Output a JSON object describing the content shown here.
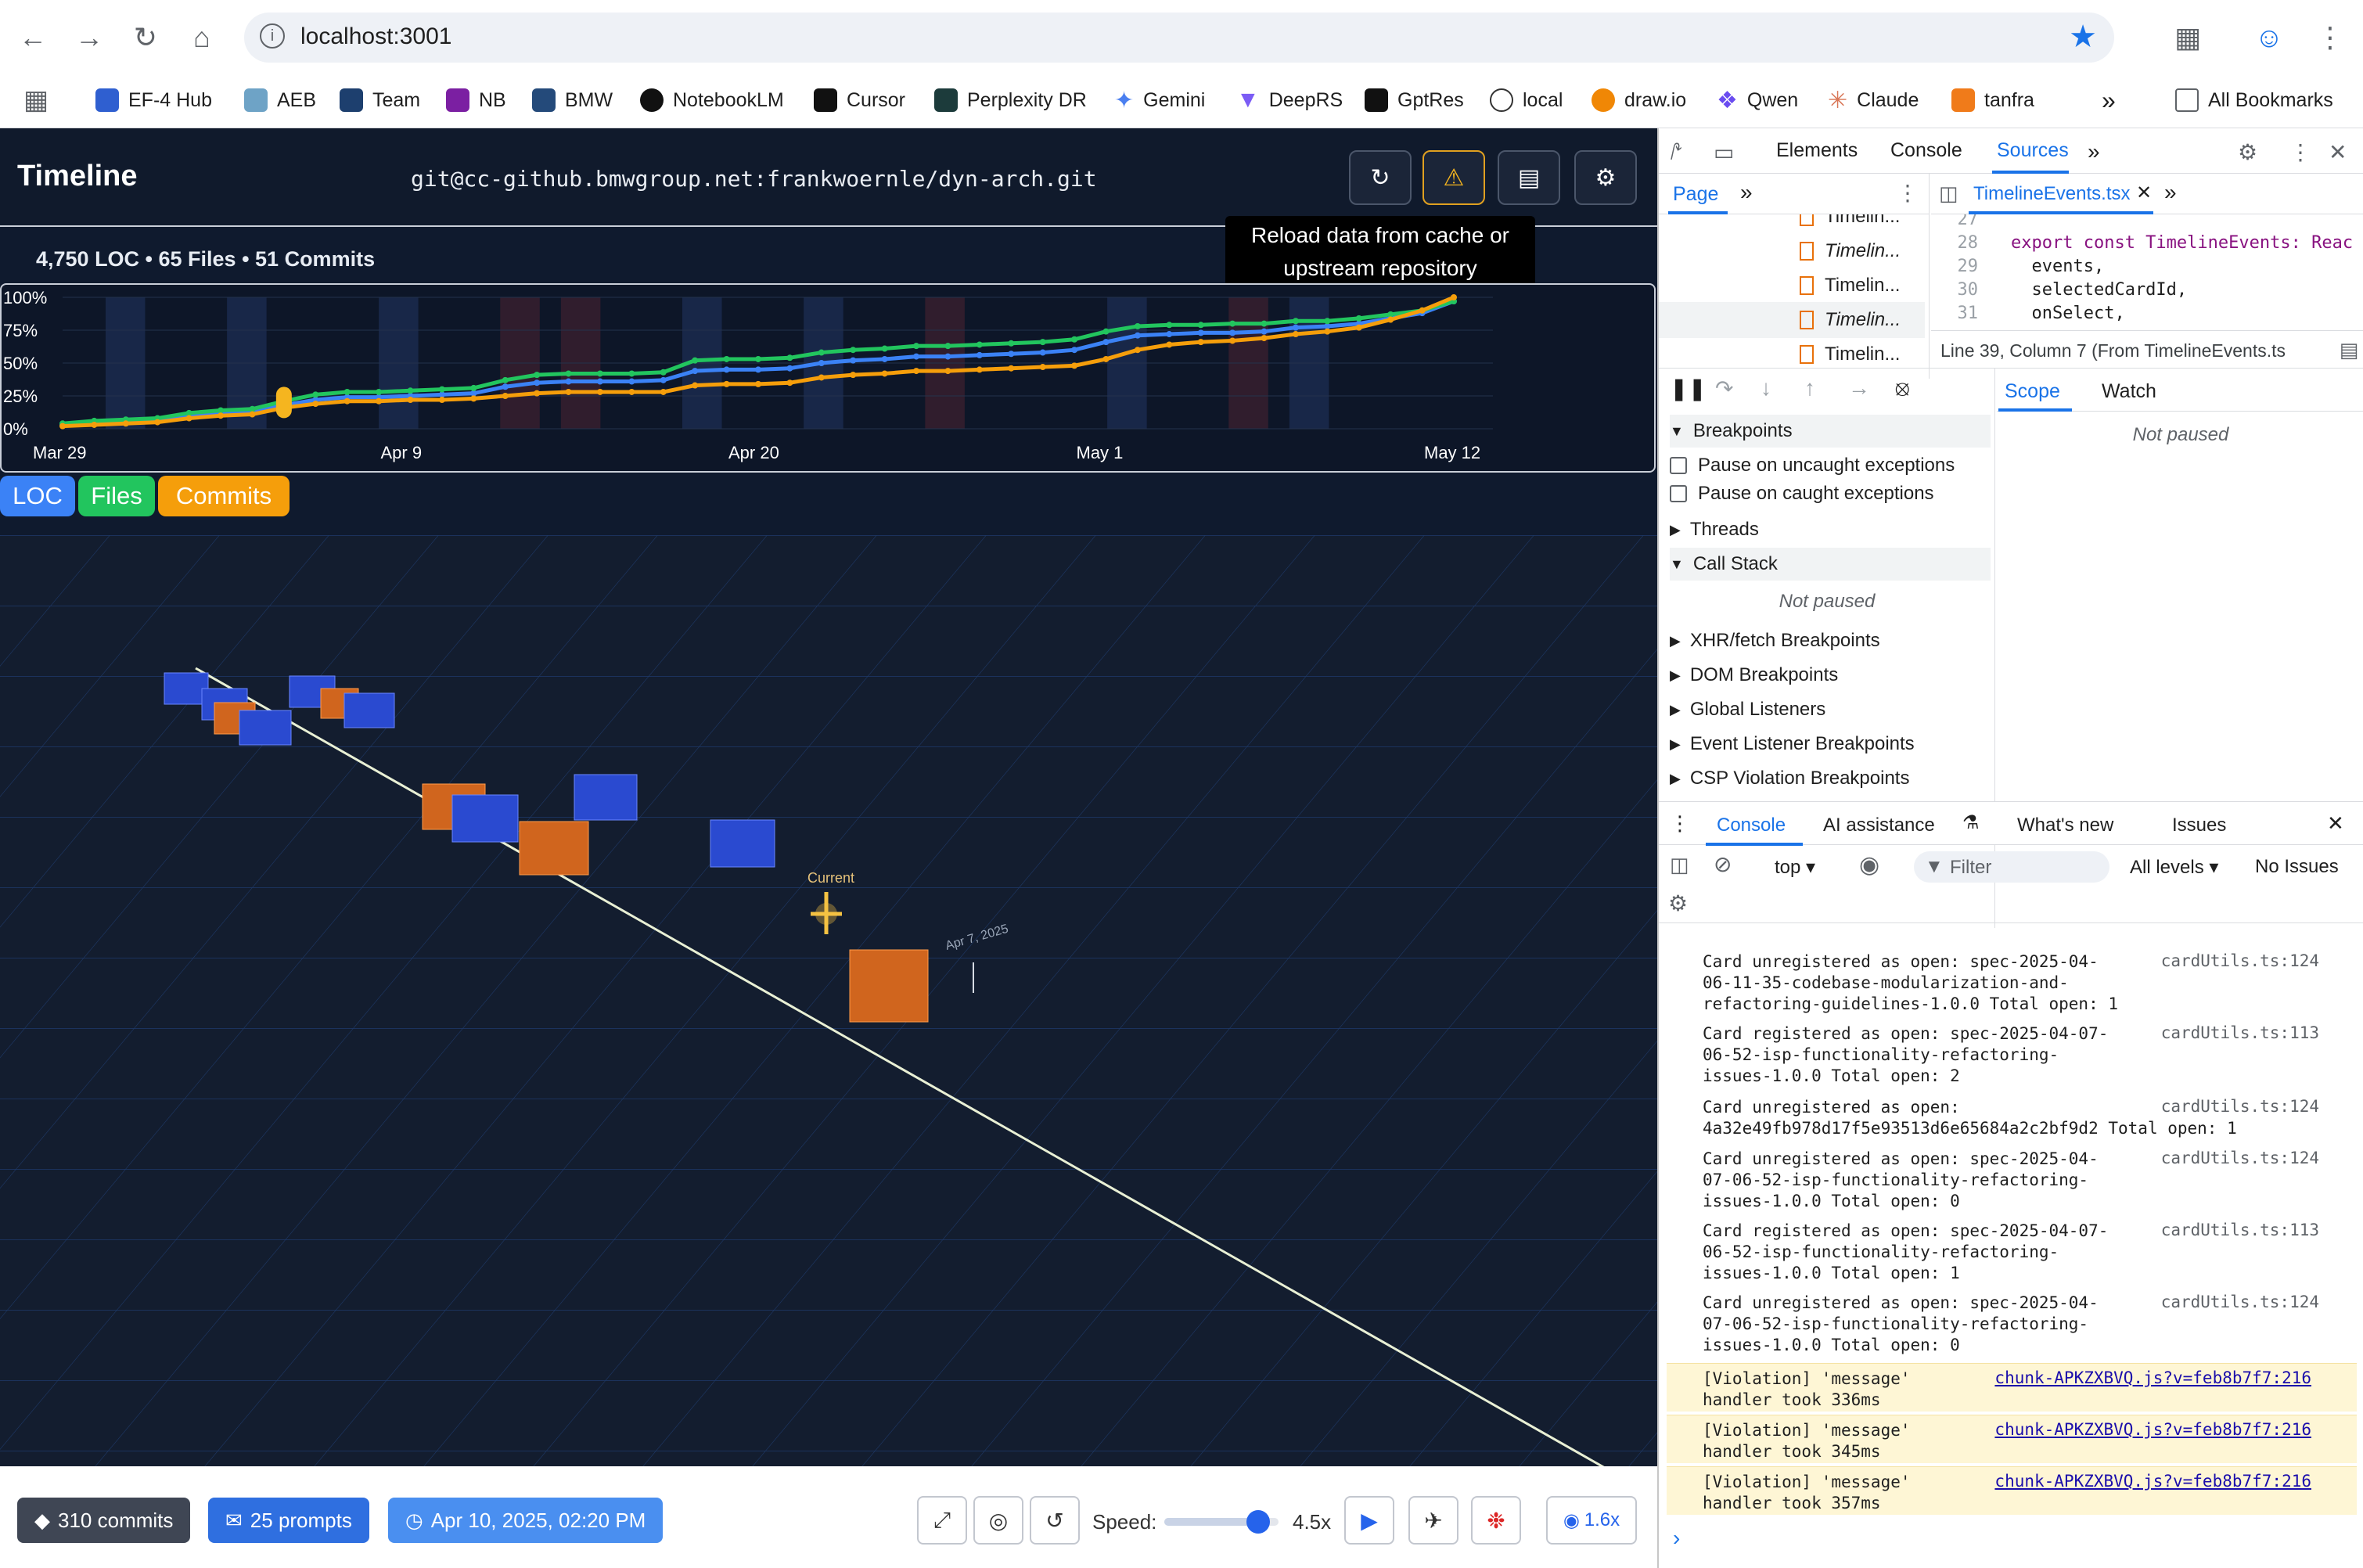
{
  "browser": {
    "url": "localhost:3001",
    "bookmarks": [
      "EF-4 Hub",
      "AEB",
      "Team",
      "NB",
      "BMW",
      "NotebookLM",
      "Cursor",
      "Perplexity DR",
      "Gemini",
      "DeepRS",
      "GptRes",
      "local",
      "draw.io",
      "Qwen",
      "Claude",
      "tanfra"
    ],
    "all_bookmarks": "All Bookmarks"
  },
  "app": {
    "title": "Timeline",
    "repo": "git@cc-github.bmwgroup.net:frankwoernle/dyn-arch.git",
    "tooltip": "Reload data from cache or upstream repository",
    "stats": "4,750 LOC • 65 Files • 51 Commits",
    "legend": {
      "loc": "LOC",
      "files": "Files",
      "commits": "Commits"
    },
    "scene": {
      "current_label": "Current",
      "date_label": "Apr 7, 2025"
    },
    "footer": {
      "commits": "310 commits",
      "prompts": "25 prompts",
      "datetime": "Apr 10, 2025, 02:20 PM",
      "speed_label": "Speed:",
      "speed_value": "4.5x",
      "speed_fraction": 0.82,
      "camera_zoom": "1.6x"
    }
  },
  "chart_data": {
    "type": "line",
    "x_ticks": [
      "Mar 29",
      "Apr 9",
      "Apr 20",
      "May 1",
      "May 12"
    ],
    "y_ticks": [
      "100%",
      "75%",
      "50%",
      "25%",
      "0%"
    ],
    "ylim": [
      0,
      100
    ],
    "grid": true,
    "x": [
      0,
      1,
      2,
      3,
      4,
      5,
      6,
      7,
      8,
      9,
      10,
      11,
      12,
      13,
      14,
      15,
      16,
      17,
      18,
      19,
      20,
      21,
      22,
      23,
      24,
      25,
      26,
      27,
      28,
      29,
      30,
      31,
      32,
      33,
      34,
      35,
      36,
      37,
      38,
      39,
      40,
      41,
      42,
      43,
      44
    ],
    "series": [
      {
        "name": "LOC",
        "color": "#3b82f6",
        "values": [
          3,
          5,
          6,
          7,
          10,
          12,
          13,
          18,
          22,
          24,
          24,
          25,
          26,
          27,
          32,
          35,
          36,
          36,
          36,
          37,
          44,
          45,
          45,
          46,
          50,
          52,
          53,
          55,
          55,
          56,
          57,
          58,
          60,
          66,
          71,
          72,
          73,
          73,
          74,
          77,
          78,
          80,
          84,
          88,
          97
        ]
      },
      {
        "name": "Files",
        "color": "#22c55e",
        "values": [
          4,
          6,
          7,
          8,
          12,
          14,
          15,
          21,
          26,
          28,
          28,
          29,
          30,
          31,
          37,
          41,
          42,
          42,
          42,
          43,
          52,
          53,
          53,
          54,
          58,
          60,
          61,
          63,
          63,
          64,
          65,
          66,
          68,
          74,
          78,
          79,
          79,
          80,
          80,
          82,
          82,
          84,
          87,
          90,
          97
        ]
      },
      {
        "name": "Commits",
        "color": "#f59e0b",
        "values": [
          2,
          3,
          4,
          5,
          8,
          10,
          11,
          16,
          19,
          21,
          21,
          22,
          22,
          23,
          25,
          27,
          28,
          28,
          28,
          28,
          33,
          34,
          34,
          35,
          39,
          41,
          42,
          44,
          44,
          45,
          46,
          47,
          48,
          53,
          60,
          64,
          66,
          67,
          69,
          72,
          74,
          77,
          83,
          90,
          100
        ]
      }
    ],
    "marker": {
      "x": 7,
      "value": 20
    }
  },
  "devtools": {
    "tabs": [
      "Elements",
      "Console",
      "Sources"
    ],
    "active_tab": "Sources",
    "nav": {
      "page_tab": "Page",
      "files": [
        "Timelin...",
        "Timelin...",
        "Timelin...",
        "Timelin...",
        "Timelin..."
      ]
    },
    "editor": {
      "file_tab": "TimelineEvents.tsx",
      "lines": [
        {
          "num": "27",
          "text": ""
        },
        {
          "num": "28",
          "text": "export const TimelineEvents: Reac"
        },
        {
          "num": "29",
          "text": "  events,"
        },
        {
          "num": "30",
          "text": "  selectedCardId,"
        },
        {
          "num": "31",
          "text": "  onSelect,"
        }
      ],
      "status": "Line 39, Column 7  (From TimelineEvents.ts"
    },
    "debugger": {
      "breakpoints": "Breakpoints",
      "pause_uncaught": "Pause on uncaught exceptions",
      "pause_caught": "Pause on caught exceptions",
      "threads": "Threads",
      "call_stack": "Call Stack",
      "not_paused": "Not paused",
      "sections": [
        "XHR/fetch Breakpoints",
        "DOM Breakpoints",
        "Global Listeners",
        "Event Listener Breakpoints",
        "CSP Violation Breakpoints"
      ],
      "scope_tab": "Scope",
      "watch_tab": "Watch",
      "scope_status": "Not paused"
    },
    "drawer": {
      "tabs": [
        "Console",
        "AI assistance",
        "What's new",
        "Issues"
      ],
      "context": "top",
      "filter_placeholder": "Filter",
      "levels": "All levels",
      "issues": "No Issues",
      "messages": [
        {
          "text": "Card unregistered as open: spec-2025-04-06-11-35-codebase-modularization-and-refactoring-guidelines-1.0.0 Total open: 1",
          "src": "cardUtils.ts:124"
        },
        {
          "text": "Card registered as open: spec-2025-04-07-06-52-isp-functionality-refactoring-issues-1.0.0 Total open: 2",
          "src": "cardUtils.ts:113"
        },
        {
          "text": "Card unregistered as open: 4a32e49fb978d17f5e93513d6e65684a2c2bf9d2 Total open: 1",
          "src": "cardUtils.ts:124"
        },
        {
          "text": "Card unregistered as open: spec-2025-04-07-06-52-isp-functionality-refactoring-issues-1.0.0 Total open: 0",
          "src": "cardUtils.ts:124"
        },
        {
          "text": "Card registered as open: spec-2025-04-07-06-52-isp-functionality-refactoring-issues-1.0.0 Total open: 1",
          "src": "cardUtils.ts:113"
        },
        {
          "text": "Card unregistered as open: spec-2025-04-07-06-52-isp-functionality-refactoring-issues-1.0.0 Total open: 0",
          "src": "cardUtils.ts:124"
        }
      ],
      "violations": [
        {
          "text": "[Violation] 'message' handler took 336ms",
          "src": "chunk-APKZXBVQ.js?v=feb8b7f7:216"
        },
        {
          "text": "[Violation] 'message' handler took 345ms",
          "src": "chunk-APKZXBVQ.js?v=feb8b7f7:216"
        },
        {
          "text": "[Violation] 'message' handler took 357ms",
          "src": "chunk-APKZXBVQ.js?v=feb8b7f7:216"
        }
      ]
    }
  }
}
